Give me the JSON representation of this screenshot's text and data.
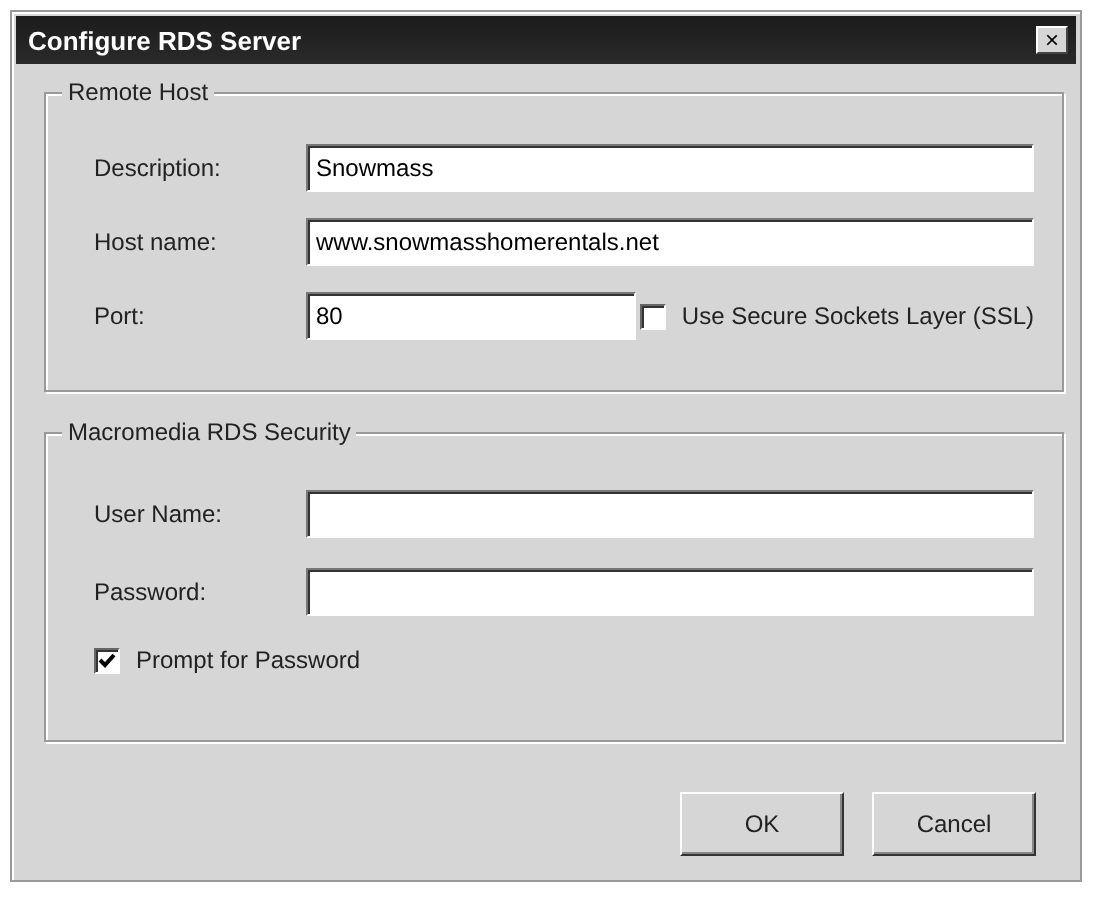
{
  "window": {
    "title": "Configure RDS Server",
    "close": "×"
  },
  "groups": [
    {
      "title": "Remote Host",
      "fields": [
        {
          "kind": "text",
          "label": "Description:",
          "value": "Snowmass"
        },
        {
          "kind": "text",
          "label": "Host name:",
          "value": "www.snowmasshomerentals.net"
        },
        {
          "kind": "port",
          "label": "Port:",
          "value": "80",
          "checkbox": {
            "label": "Use Secure Sockets Layer (SSL)",
            "checked": false
          }
        }
      ]
    },
    {
      "title": "Macromedia RDS Security",
      "fields": [
        {
          "kind": "text",
          "label": "User Name:"
        },
        {
          "kind": "text",
          "label": "Password:"
        },
        {
          "kind": "check",
          "checkbox": {
            "label": "Prompt for Password",
            "checked": true
          }
        }
      ]
    }
  ],
  "buttons": [
    "OK",
    "Cancel"
  ]
}
